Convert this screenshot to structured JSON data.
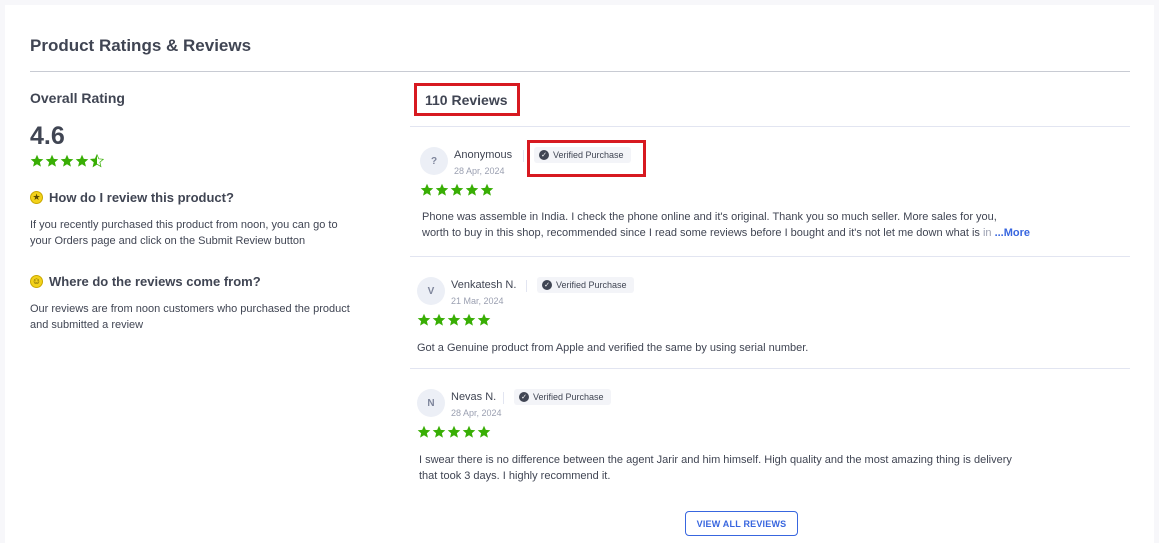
{
  "header": {
    "title": "Product Ratings & Reviews"
  },
  "overall": {
    "label": "Overall Rating",
    "value": "4.6",
    "stars": 4.5
  },
  "faq": [
    {
      "icon": "star-coin-icon",
      "question": "How do I review this product?",
      "answer": "If you recently purchased this product from noon, you can go to your Orders page and click on the Submit Review button"
    },
    {
      "icon": "smiley-icon",
      "question": "Where do the reviews come from?",
      "answer": "Our reviews are from noon customers who purchased the product and submitted a review"
    }
  ],
  "reviews_summary": {
    "count_label": "110 Reviews"
  },
  "reviews": [
    {
      "avatar": "?",
      "name": "Anonymous",
      "date": "28 Apr, 2024",
      "badge": "Verified Purchase",
      "rating": 5,
      "text_line1": "Phone was assemble in India. I check the phone online and it's original. Thank you so much seller. More sales for you,",
      "text_line2": "worth to buy in this shop, recommended since I read some reviews before I bought and it's not let me down what is",
      "text_fade": " in",
      "more_label": " ...More"
    },
    {
      "avatar": "V",
      "name": "Venkatesh N.",
      "date": "21 Mar, 2024",
      "badge": "Verified Purchase",
      "rating": 5,
      "text": "Got a Genuine product from Apple and verified the same by using serial number."
    },
    {
      "avatar": "N",
      "name": "Nevas N.",
      "date": "28 Apr, 2024",
      "badge": "Verified Purchase",
      "rating": 5,
      "text_line1": "I swear there is no difference between the agent Jarir and him himself. High quality and the most amazing thing is delivery",
      "text_line2": "that took 3 days. I highly recommend it."
    }
  ],
  "actions": {
    "view_all_label": "VIEW ALL REVIEWS"
  },
  "colors": {
    "star_green": "#38ae04",
    "highlight_red": "#d71920",
    "link_blue": "#3866df"
  }
}
